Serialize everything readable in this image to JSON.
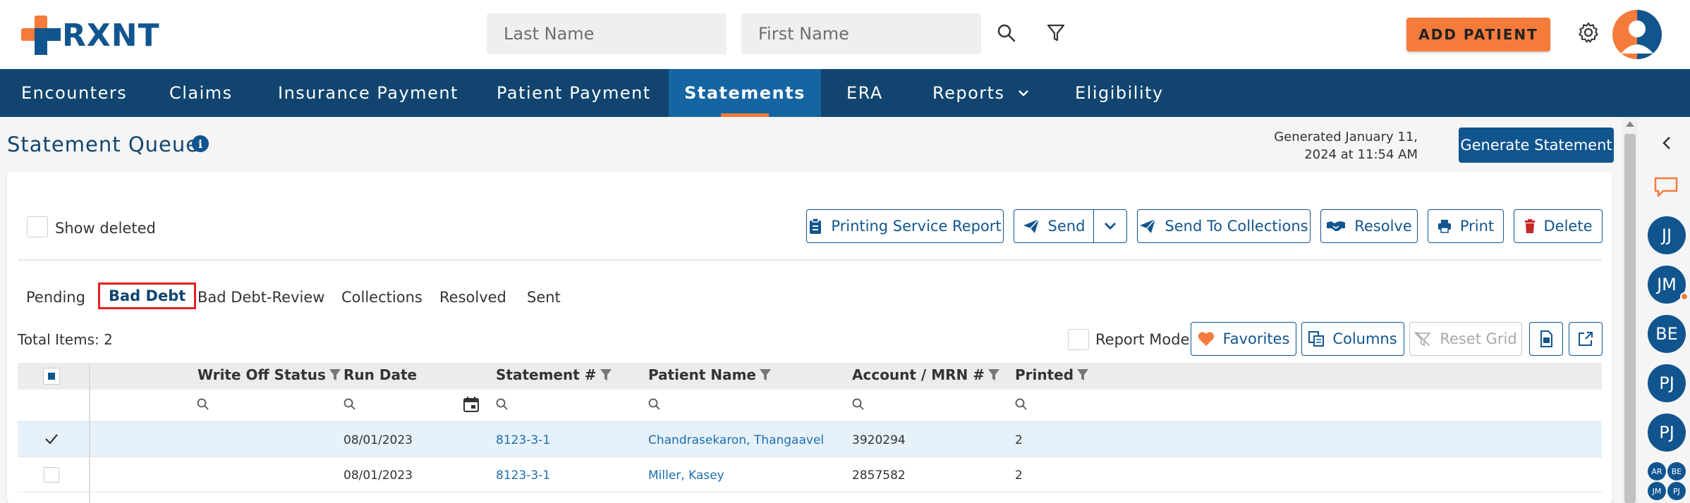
{
  "brand": {
    "name": "RXNT"
  },
  "header": {
    "last_name_placeholder": "Last Name",
    "first_name_placeholder": "First Name",
    "add_patient_label": "ADD PATIENT"
  },
  "nav": {
    "items": [
      {
        "label": "Encounters"
      },
      {
        "label": "Claims"
      },
      {
        "label": "Insurance Payment"
      },
      {
        "label": "Patient Payment"
      },
      {
        "label": "Statements"
      },
      {
        "label": "ERA"
      },
      {
        "label": "Reports"
      },
      {
        "label": "Eligibility"
      }
    ]
  },
  "page": {
    "title": "Statement Queue",
    "generated": "Generated January 11, 2024 at 11:54 AM",
    "generated_line1": "Generated January 11,",
    "generated_line2": "2024 at 11:54 AM",
    "generate_button": "Generate Statement"
  },
  "toolbar": {
    "show_deleted": "Show deleted",
    "printing_service_report": "Printing Service Report",
    "send": "Send",
    "send_to_collections": "Send To Collections",
    "resolve": "Resolve",
    "print": "Print",
    "delete": "Delete"
  },
  "tabs": [
    {
      "label": "Pending"
    },
    {
      "label": "Bad Debt"
    },
    {
      "label": "Bad Debt-Review"
    },
    {
      "label": "Collections"
    },
    {
      "label": "Resolved"
    },
    {
      "label": "Sent"
    }
  ],
  "grid_toolbar": {
    "total_items": "Total Items: 2",
    "report_mode": "Report Mode",
    "favorites": "Favorites",
    "columns": "Columns",
    "reset_grid": "Reset Grid"
  },
  "table": {
    "columns": [
      "Write Off Status",
      "Run Date",
      "Statement #",
      "Patient Name",
      "Account / MRN #",
      "Printed"
    ],
    "rows": [
      {
        "selected": true,
        "write_off_status": "",
        "run_date": "08/01/2023",
        "statement": "8123-3-1",
        "patient_name": "Chandrasekaron, Thangaavel",
        "account": "3920294",
        "printed": "2"
      },
      {
        "selected": false,
        "write_off_status": "",
        "run_date": "08/01/2023",
        "statement": "8123-3-1",
        "patient_name": "Miller, Kasey",
        "account": "2857582",
        "printed": "2"
      }
    ]
  },
  "rail": {
    "avatars": [
      "JJ",
      "JM",
      "BE",
      "PJ",
      "PJ"
    ],
    "mini_avatars": [
      "AR",
      "BE",
      "JM",
      "PJ"
    ]
  },
  "colors": {
    "brand_blue": "#11558f",
    "nav_bg": "#11456f",
    "accent_orange": "#f47b3a"
  }
}
